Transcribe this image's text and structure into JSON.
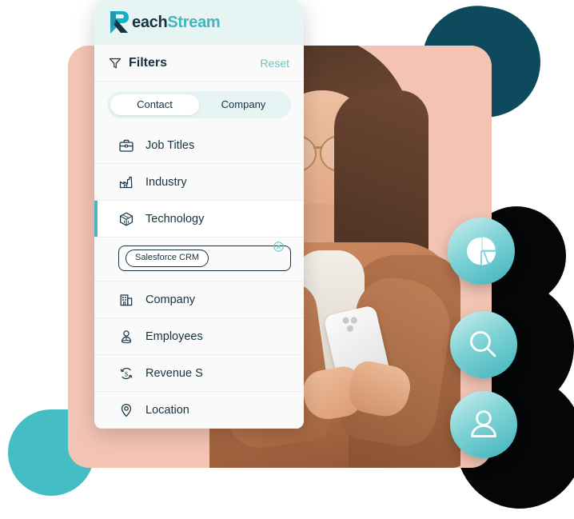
{
  "brand": {
    "name_part1": "each",
    "name_part2": "Stream",
    "logo_mark": "reachstream-r-logo",
    "accent_teal": "#45b5bd",
    "accent_dark": "#16323f"
  },
  "panel": {
    "filters_title": "Filters",
    "filter_icon": "funnel-icon",
    "reset_label": "Reset",
    "tabs": [
      {
        "label": "Contact",
        "active": true
      },
      {
        "label": "Company",
        "active": false
      }
    ],
    "filter_items": [
      {
        "label": "Job Titles",
        "icon": "briefcase-icon",
        "active": false
      },
      {
        "label": "Industry",
        "icon": "factory-icon",
        "active": false
      },
      {
        "label": "Technology",
        "icon": "cube-icon",
        "active": true
      },
      {
        "label": "Company",
        "icon": "building-icon",
        "active": false
      },
      {
        "label": "Employees",
        "icon": "person-badge-icon",
        "active": false
      },
      {
        "label": "Revenue S",
        "icon": "dollar-cycle-icon",
        "active": false
      },
      {
        "label": "Location",
        "icon": "map-pin-icon",
        "active": false
      }
    ],
    "selected_chip": {
      "label": "Salesforce CRM",
      "remove_icon": "circle-x-icon"
    }
  },
  "badges": [
    {
      "name": "analytics",
      "icon": "pie-chart-icon"
    },
    {
      "name": "search",
      "icon": "magnifier-icon"
    },
    {
      "name": "contact",
      "icon": "person-icon"
    }
  ],
  "decor": {
    "peach_card_color": "#f3c4b4",
    "dark_teal_blob_color": "#0d4a5e",
    "teal_circle_color": "#44bdc4",
    "black_blob_color": "#050608"
  },
  "photo": {
    "alt": "woman-with-phone-photo"
  }
}
